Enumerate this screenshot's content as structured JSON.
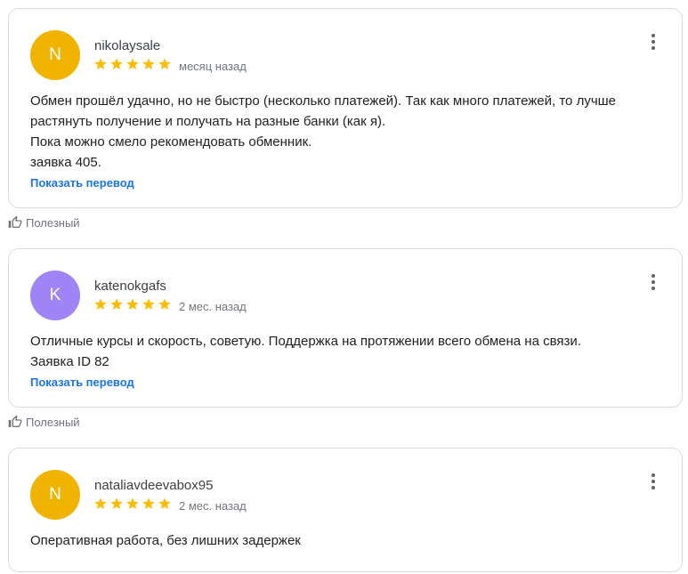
{
  "colors": {
    "star": "#fbbc04",
    "link": "#1a73e8",
    "avatar_yellow": "#f0b400",
    "avatar_purple": "#9e84f5"
  },
  "reviews": [
    {
      "initial": "N",
      "avatar_color": "#f0b400",
      "name": "nikolaysale",
      "rating": 5,
      "time": "месяц назад",
      "text_lines": [
        "Обмен прошёл удачно, но не быстро (несколько платежей). Так как много платежей, то лучше",
        "растянуть получение и получать на разные банки (как я).",
        "Пока можно смело рекомендовать обменник.",
        "заявка 405."
      ],
      "translate_label": "Показать перевод",
      "helpful_label": "Полезный"
    },
    {
      "initial": "K",
      "avatar_color": "#9e84f5",
      "name": "katenokgafs",
      "rating": 5,
      "time": "2 мес. назад",
      "text_lines": [
        "Отличные курсы и скорость, советую. Поддержка на протяжении всего обмена на связи.",
        "Заявка ID 82"
      ],
      "translate_label": "Показать перевод",
      "helpful_label": "Полезный"
    },
    {
      "initial": "N",
      "avatar_color": "#f0b400",
      "name": "nataliavdeevabox95",
      "rating": 5,
      "time": "2 мес. назад",
      "text_lines": [
        "Оперативная работа, без лишних задержек"
      ]
    }
  ]
}
